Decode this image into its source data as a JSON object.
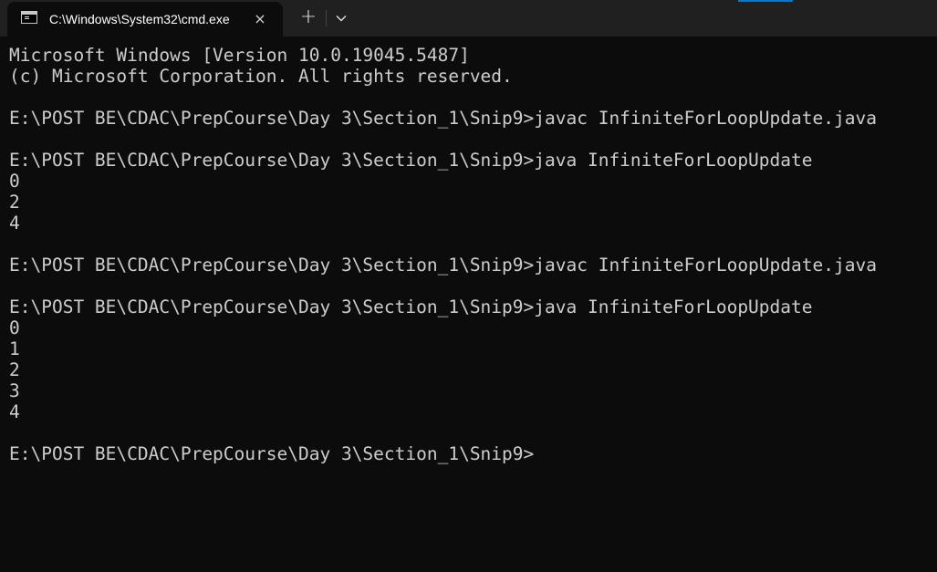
{
  "window": {
    "tab_title": "C:\\Windows\\System32\\cmd.exe",
    "tab_icon": "terminal-icon",
    "close_icon": "×",
    "new_tab_icon": "+",
    "dropdown_icon": "chevron-down-icon",
    "accent_color": "#0078d4"
  },
  "console": {
    "lines": [
      "Microsoft Windows [Version 10.0.19045.5487]",
      "(c) Microsoft Corporation. All rights reserved.",
      "",
      "E:\\POST BE\\CDAC\\PrepCourse\\Day 3\\Section_1\\Snip9>javac InfiniteForLoopUpdate.java",
      "",
      "E:\\POST BE\\CDAC\\PrepCourse\\Day 3\\Section_1\\Snip9>java InfiniteForLoopUpdate",
      "0",
      "2",
      "4",
      "",
      "E:\\POST BE\\CDAC\\PrepCourse\\Day 3\\Section_1\\Snip9>javac InfiniteForLoopUpdate.java",
      "",
      "E:\\POST BE\\CDAC\\PrepCourse\\Day 3\\Section_1\\Snip9>java InfiniteForLoopUpdate",
      "0",
      "1",
      "2",
      "3",
      "4",
      "",
      "E:\\POST BE\\CDAC\\PrepCourse\\Day 3\\Section_1\\Snip9>"
    ]
  }
}
